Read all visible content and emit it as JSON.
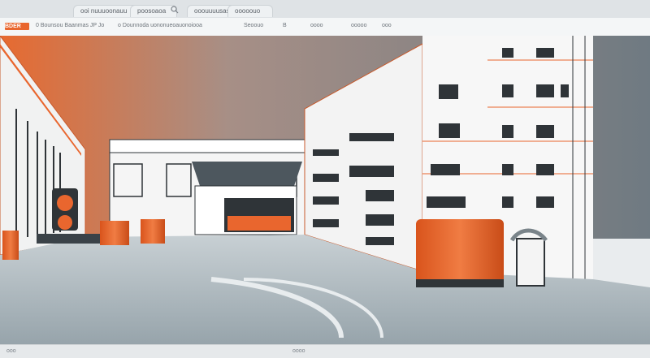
{
  "tabs": [
    {
      "label": "ooi nuuuoonauu"
    },
    {
      "label": "poosoaoa"
    },
    {
      "label": "ooouuuusas"
    },
    {
      "label": "ooooouo"
    }
  ],
  "toolbar": {
    "brand": "BDER",
    "path": "0 Bounsou Baanmas JP Jo",
    "url": "o Dounnoda uononueoauonoiooa",
    "field_a": "Seoouo",
    "field_b": "B",
    "field_c": "oooo",
    "field_d": "ooooo",
    "field_e": "ooo"
  },
  "scene": {
    "description_icon": "image-icon"
  },
  "status": {
    "left": "ooo",
    "center": "oooo"
  },
  "colors": {
    "accent": "#e9662e",
    "sky_top": "#7b858c",
    "floor": "#b9c3c8"
  }
}
